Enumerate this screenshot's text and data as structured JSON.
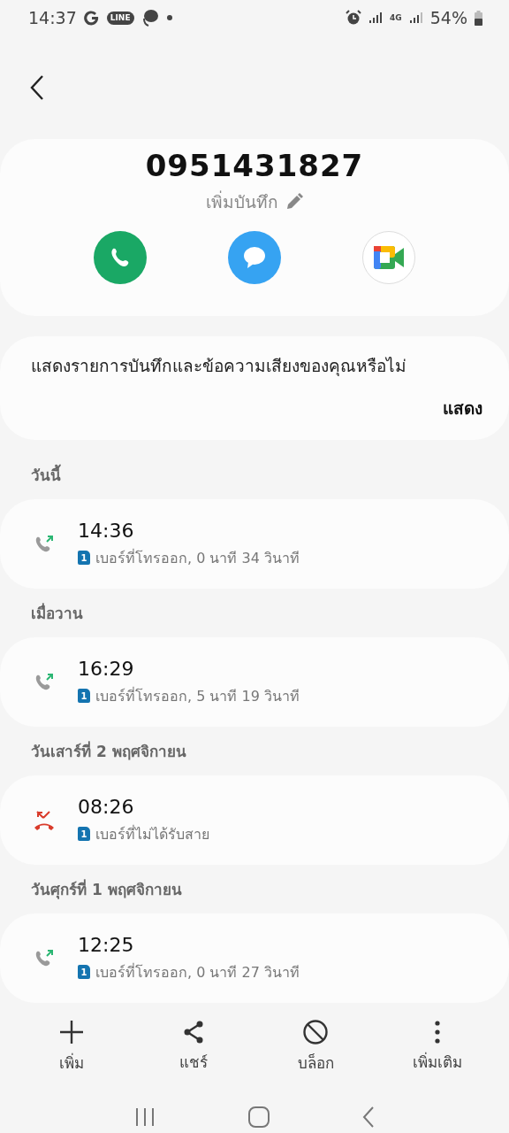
{
  "status_bar": {
    "time": "14:37",
    "line_badge": "LINE",
    "network": "4G",
    "battery": "54%"
  },
  "contact": {
    "number": "0951431827",
    "note_hint": "เพิ่มบันทึก"
  },
  "notice": {
    "text": "แสดงรายการบันทึกและข้อความเสียงของคุณหรือไม่",
    "action": "แสดง"
  },
  "call_groups": [
    {
      "date": "วันนี้",
      "calls": [
        {
          "kind": "outgoing",
          "time": "14:36",
          "sim": "1",
          "detail": "เบอร์ที่โทรออก, 0 นาที 34 วินาที"
        }
      ]
    },
    {
      "date": "เมื่อวาน",
      "calls": [
        {
          "kind": "outgoing",
          "time": "16:29",
          "sim": "1",
          "detail": "เบอร์ที่โทรออก, 5 นาที 19 วินาที"
        }
      ]
    },
    {
      "date": "วันเสาร์ที่ 2 พฤศจิกายน",
      "calls": [
        {
          "kind": "missed",
          "time": "08:26",
          "sim": "1",
          "detail": "เบอร์ที่ไม่ได้รับสาย"
        }
      ]
    },
    {
      "date": "วันศุกร์ที่ 1 พฤศจิกายน",
      "calls": [
        {
          "kind": "outgoing",
          "time": "12:25",
          "sim": "1",
          "detail": "เบอร์ที่โทรออก, 0 นาที 27 วินาที"
        }
      ]
    }
  ],
  "toolbar": [
    {
      "kind": "add",
      "label": "เพิ่ม"
    },
    {
      "kind": "share",
      "label": "แชร์"
    },
    {
      "kind": "block",
      "label": "บล็อก"
    },
    {
      "kind": "more",
      "label": "เพิ่มเติม"
    }
  ]
}
